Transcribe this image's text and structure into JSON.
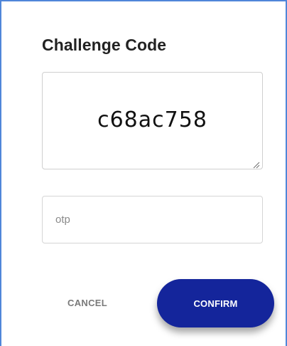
{
  "dialog": {
    "title": "Challenge Code",
    "challenge_code": "c68ac758",
    "otp": {
      "value": "",
      "placeholder": "otp"
    },
    "buttons": {
      "cancel_label": "CANCEL",
      "confirm_label": "CONFIRM"
    }
  },
  "colors": {
    "accent": "#14259b",
    "frame_edge": "#4f86d9",
    "title_text": "#222222",
    "cancel_text": "#7a7a7a"
  },
  "icons": {
    "resize_grip": "resize-grip-icon"
  }
}
